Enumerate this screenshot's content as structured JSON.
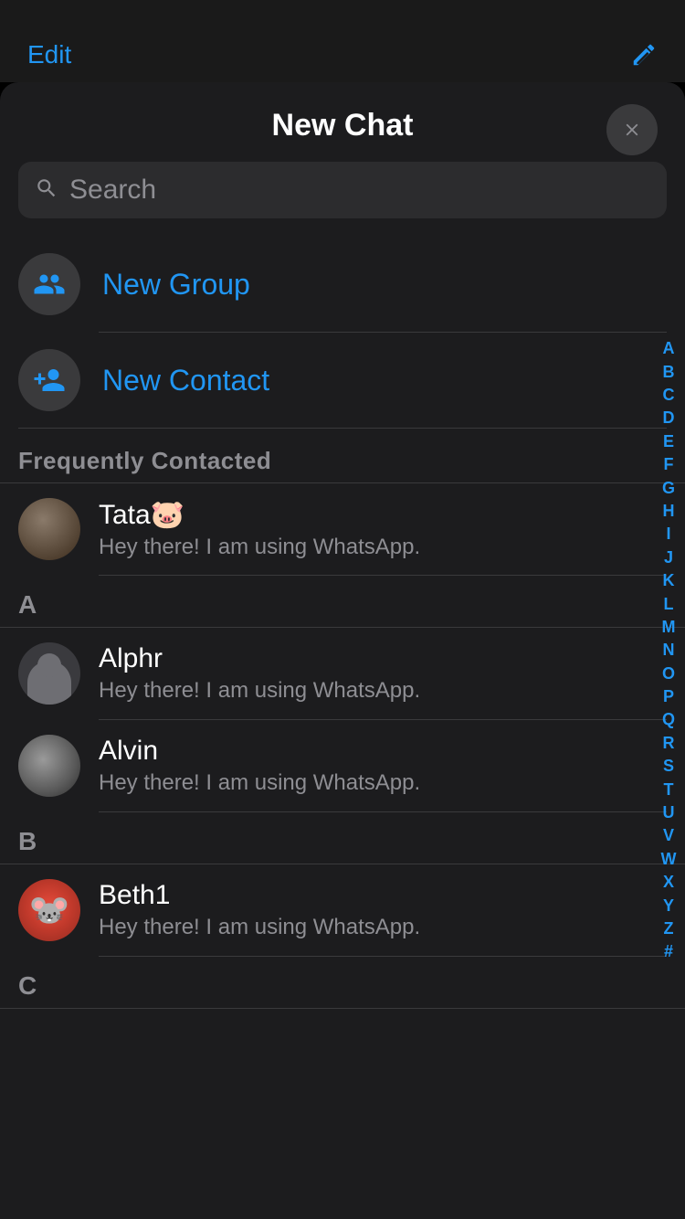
{
  "statusBar": {
    "editLabel": "Edit",
    "composeIcon": "compose-icon"
  },
  "modal": {
    "title": "New Chat",
    "closeLabel": "✕"
  },
  "search": {
    "placeholder": "Search"
  },
  "actions": [
    {
      "id": "new-group",
      "label": "New Group",
      "icon": "group-icon"
    },
    {
      "id": "new-contact",
      "label": "New Contact",
      "icon": "add-contact-icon"
    }
  ],
  "frequentlyContacted": {
    "sectionLabel": "Frequently Contacted",
    "contacts": [
      {
        "id": "tata",
        "name": "Tata🐷",
        "status": "Hey there! I am using WhatsApp.",
        "avatarType": "tata"
      }
    ]
  },
  "alphabetSections": [
    {
      "letter": "A",
      "contacts": [
        {
          "id": "alphr",
          "name": "Alphr",
          "status": "Hey there! I am using WhatsApp.",
          "avatarType": "alphr"
        },
        {
          "id": "alvin",
          "name": "Alvin",
          "status": "Hey there! I am using WhatsApp.",
          "avatarType": "alvin"
        }
      ]
    },
    {
      "letter": "B",
      "contacts": [
        {
          "id": "beth1",
          "name": "Beth1",
          "status": "Hey there! I am using WhatsApp.",
          "avatarType": "beth"
        }
      ]
    },
    {
      "letter": "C",
      "contacts": []
    }
  ],
  "alphabetIndex": [
    "A",
    "B",
    "C",
    "D",
    "E",
    "F",
    "G",
    "H",
    "I",
    "J",
    "K",
    "L",
    "M",
    "N",
    "O",
    "P",
    "Q",
    "R",
    "S",
    "T",
    "U",
    "V",
    "W",
    "X",
    "Y",
    "Z",
    "#"
  ]
}
